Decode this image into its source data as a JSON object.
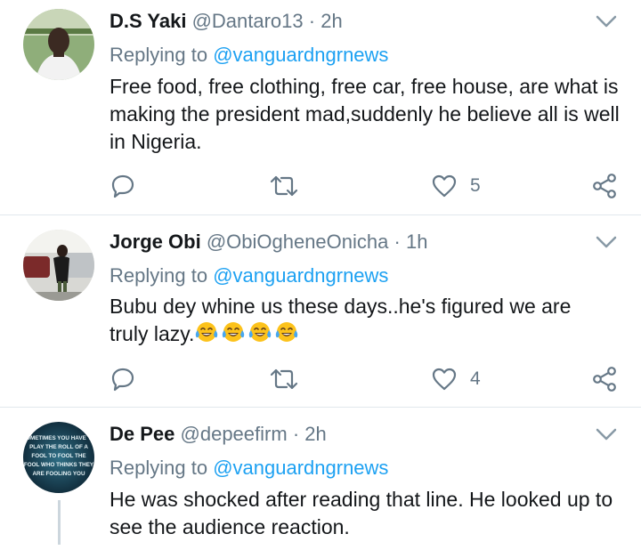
{
  "reply_prefix": "Replying to",
  "tweets": [
    {
      "name": "D.S Yaki",
      "handle": "@Dantaro13",
      "separator": "·",
      "time": "2h",
      "replying_to": "@vanguardngrnews",
      "text": "Free food, free clothing, free car, free house, are what is making the president mad,suddenly he believe all is well in Nigeria.",
      "likes": "5"
    },
    {
      "name": "Jorge Obi",
      "handle": "@ObiOgheneOnicha",
      "separator": "·",
      "time": "1h",
      "replying_to": "@vanguardngrnews",
      "text_line1": "Bubu dey whine us these days..he's figured we are",
      "text_line2": "truly lazy.",
      "emoji": [
        "face-with-tears-of-joy",
        "face-with-tears-of-joy",
        "face-with-tears-of-joy",
        "face-with-tears-of-joy"
      ],
      "likes": "4"
    },
    {
      "name": "De Pee",
      "handle": "@depeefirm",
      "separator": "·",
      "time": "2h",
      "replying_to": "@vanguardngrnews",
      "text": "He was shocked after reading that line. He looked up to see the audience reaction.",
      "avatar_text": [
        "SOMETIMES YOU HAVE TO",
        "PLAY THE ROLL OF A",
        "FOOL TO FOOL THE",
        "FOOL WHO THINKS THEY",
        "ARE FOOLING YOU"
      ]
    }
  ],
  "colors": {
    "mention": "#1da1f2",
    "secondary": "#657786",
    "divider": "#e1e8ed"
  },
  "icons": {
    "reply": "speech-bubble-icon",
    "retweet": "retweet-icon",
    "like": "heart-icon",
    "share": "share-icon",
    "menu": "chevron-down-icon"
  }
}
